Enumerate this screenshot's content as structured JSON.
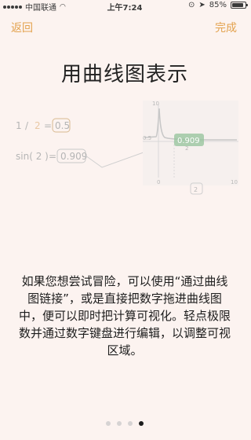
{
  "status_bar": {
    "carrier": "中国联通",
    "time": "上午7:24",
    "battery": "85%",
    "battery_level": 0.85
  },
  "nav": {
    "back_label": "返回",
    "done_label": "完成"
  },
  "title": "用曲线图表示",
  "illustration": {
    "expression_1": {
      "left": "1",
      "op": "/",
      "right": "2",
      "eq": "=",
      "result": "0.5"
    },
    "expression_2": {
      "func": "sin( 2 )",
      "eq": "=",
      "result": "0.909"
    },
    "graph": {
      "y_top_tick": "10",
      "y_value_tick": "0.5",
      "x_start": "0",
      "x_end": "10",
      "value_badge": "0.909",
      "x_marker": "2",
      "axis_badge": "2"
    }
  },
  "description": "如果您想尝试冒险，可以使用“通过曲线图链接”，或是直接把数字拖进曲线图中，便可以即时把计算可视化。轻点极限数并通过数字键盘进行编辑，以调整可视区域。",
  "pagination": {
    "count": 4,
    "active_index": 3
  },
  "colors": {
    "accent": "#e3a24e",
    "highlight": "#93c39a",
    "background": "#fcf3f0"
  }
}
